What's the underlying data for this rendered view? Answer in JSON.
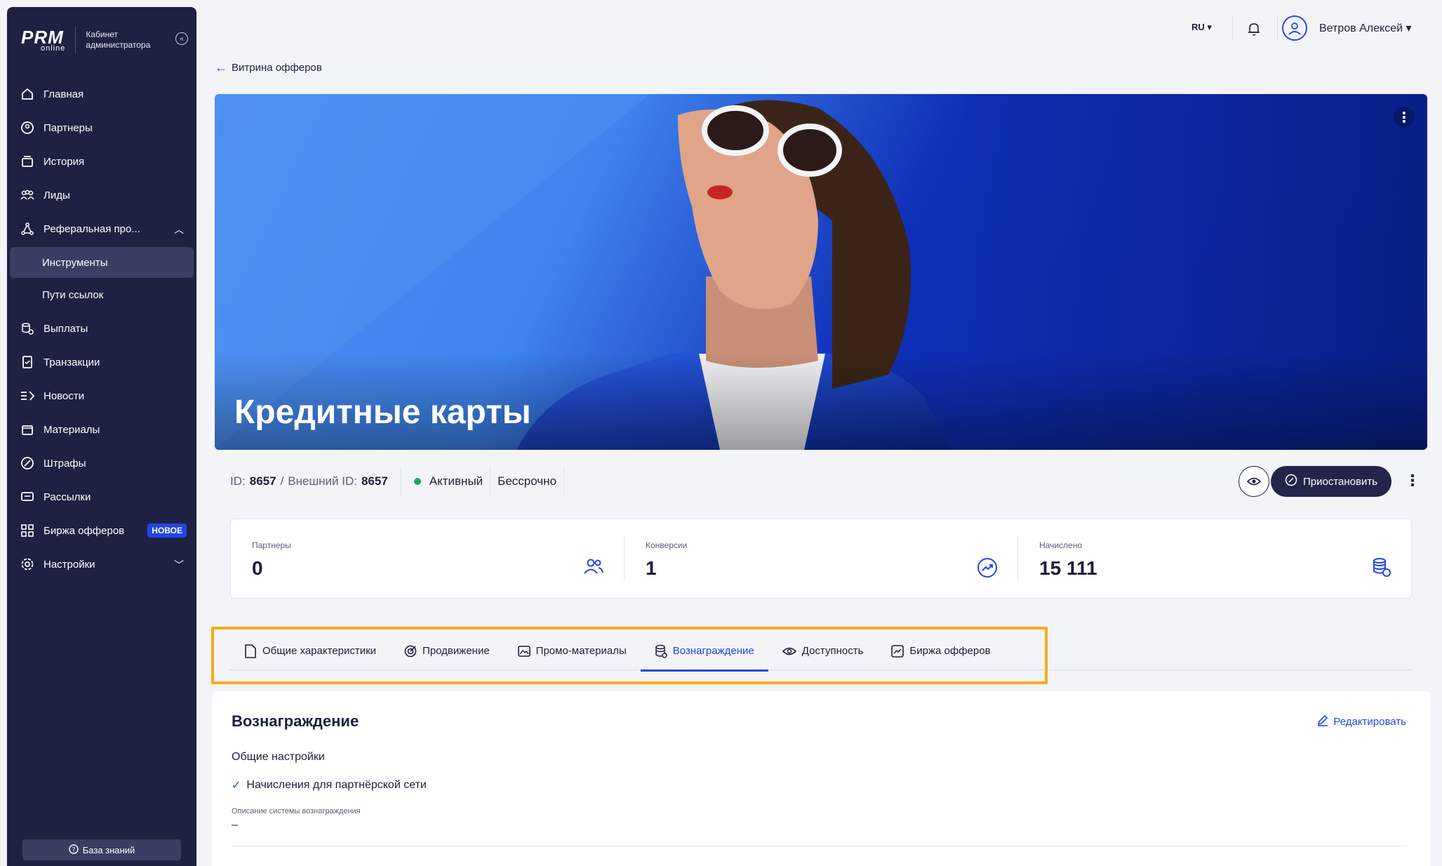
{
  "brand": {
    "logo_main": "PRM",
    "logo_sub": "online",
    "cabinet_title": "Кабинет администратора"
  },
  "sidebar": {
    "items": [
      {
        "label": "Главная",
        "icon": "home-icon"
      },
      {
        "label": "Партнеры",
        "icon": "partners-icon"
      },
      {
        "label": "История",
        "icon": "history-icon"
      },
      {
        "label": "Лиды",
        "icon": "leads-icon"
      },
      {
        "label": "Реферальная про...",
        "icon": "referral-icon"
      },
      {
        "label": "Инструменты"
      },
      {
        "label": "Пути ссылок"
      },
      {
        "label": "Выплаты",
        "icon": "payouts-icon"
      },
      {
        "label": "Транзакции",
        "icon": "transactions-icon"
      },
      {
        "label": "Новости",
        "icon": "news-icon"
      },
      {
        "label": "Материалы",
        "icon": "materials-icon"
      },
      {
        "label": "Штрафы",
        "icon": "fines-icon"
      },
      {
        "label": "Рассылки",
        "icon": "mailings-icon"
      },
      {
        "label": "Биржа офферов",
        "icon": "offers-exchange-icon",
        "badge": "НОВОЕ"
      },
      {
        "label": "Настройки",
        "icon": "settings-icon"
      }
    ],
    "knowledge_base": "База знаний"
  },
  "topbar": {
    "lang": "RU ▾",
    "user_name": "Ветров Алексей ▾"
  },
  "back_link": "Витрина офферов",
  "hero": {
    "title": "Кредитные карты"
  },
  "info": {
    "id_label": "ID:",
    "id_value": "8657",
    "ext_label": "Внешний ID:",
    "ext_value": "8657",
    "status": "Активный",
    "duration": "Бессрочно",
    "pause_label": "Приостановить"
  },
  "stats": [
    {
      "label": "Партнеры",
      "value": "0"
    },
    {
      "label": "Конверсии",
      "value": "1"
    },
    {
      "label": "Начислено",
      "value": "15 111"
    }
  ],
  "tabs": [
    {
      "label": "Общие характеристики"
    },
    {
      "label": "Продвижение"
    },
    {
      "label": "Промо-материалы"
    },
    {
      "label": "Вознаграждение"
    },
    {
      "label": "Доступность"
    },
    {
      "label": "Биржа офферов"
    }
  ],
  "reward": {
    "title": "Вознаграждение",
    "edit_label": "Редактировать",
    "general_settings": "Общие настройки",
    "network_accruals": "Начисления для партнёрской сети",
    "description_label": "Описание системы вознаграждения",
    "description_value": "–"
  },
  "colors": {
    "accent": "#2446e6",
    "sidebar_bg": "#1e2142",
    "highlight": "#f9a91b",
    "status_active": "#1fa55b"
  }
}
